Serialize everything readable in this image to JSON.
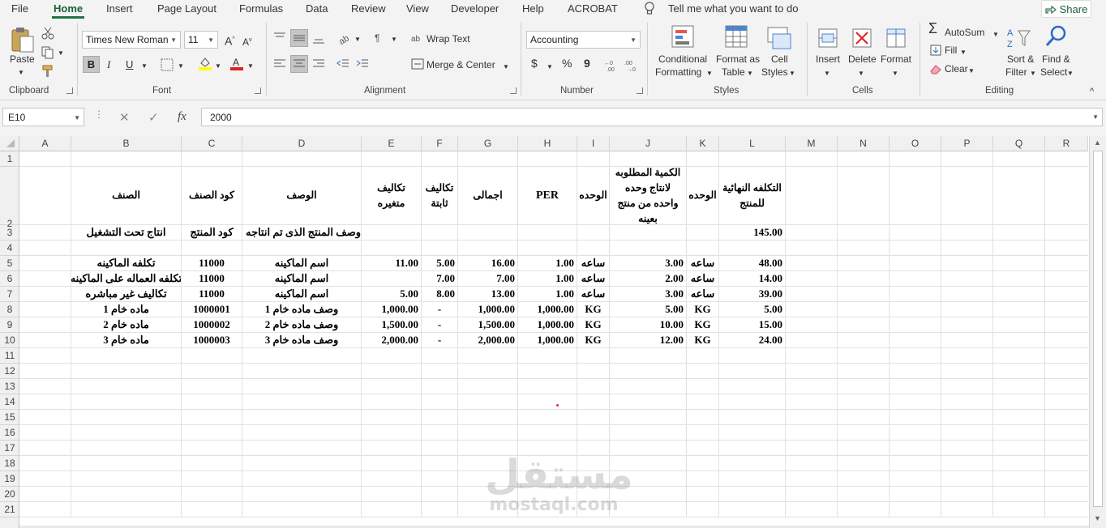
{
  "menu": {
    "tabs": [
      "File",
      "Home",
      "Insert",
      "Page Layout",
      "Formulas",
      "Data",
      "Review",
      "View",
      "Developer",
      "Help",
      "ACROBAT"
    ],
    "tell_me": "Tell me what you want to do",
    "share": "Share"
  },
  "ribbon": {
    "clipboard": {
      "paste": "Paste",
      "label": "Clipboard"
    },
    "font": {
      "name": "Times New Roman",
      "size": "11",
      "bold": "B",
      "italic": "I",
      "underline": "U",
      "label": "Font"
    },
    "alignment": {
      "wrap_text": "Wrap Text",
      "merge_center": "Merge & Center",
      "label": "Alignment"
    },
    "number": {
      "format": "Accounting",
      "currency": "$",
      "percent": "%",
      "comma": "9",
      "label": "Number"
    },
    "styles": {
      "conditional_formatting": [
        "Conditional",
        "Formatting"
      ],
      "format_as_table": [
        "Format as",
        "Table"
      ],
      "cell_styles": [
        "Cell",
        "Styles"
      ],
      "label": "Styles"
    },
    "cells": {
      "insert": "Insert",
      "delete": "Delete",
      "format": "Format",
      "label": "Cells"
    },
    "editing": {
      "autosum": "AutoSum",
      "fill": "Fill",
      "clear": "Clear",
      "sort_filter": [
        "Sort &",
        "Filter"
      ],
      "find_select": [
        "Find &",
        "Select"
      ],
      "label": "Editing"
    }
  },
  "formula_bar": {
    "name_box": "E10",
    "fx": "fx",
    "value": "2000"
  },
  "columns": [
    "A",
    "B",
    "C",
    "D",
    "E",
    "F",
    "G",
    "H",
    "I",
    "J",
    "K",
    "L",
    "M",
    "N",
    "O",
    "P",
    "Q",
    "R"
  ],
  "rows": [
    "1",
    "2",
    "3",
    "4",
    "5",
    "6",
    "7",
    "8",
    "9",
    "10",
    "11",
    "12",
    "13",
    "14",
    "15",
    "16",
    "17",
    "18",
    "19",
    "20",
    "21"
  ],
  "sheet": {
    "header": {
      "B": "الصنف",
      "C": "كود الصنف",
      "D": "الوصف",
      "E": "تكاليف متغيره",
      "F": "تكاليف ثابتة",
      "G": "اجمالى",
      "H": "PER",
      "I": "الوحده",
      "J": "الكمية المطلوبه لانتاج وحده واحده من منتج بعينه",
      "K": "الوحده",
      "L": "التكلفه النهائية للمنتج"
    },
    "row3": {
      "B": "انتاج تحت التشغيل",
      "C": "كود المنتج",
      "D": "وصف المنتج الذى تم انتاجه",
      "L": "145.00"
    },
    "data": [
      {
        "row": "5",
        "B": "تكلفه الماكينه",
        "C": "11000",
        "D": "اسم الماكينه",
        "E": "11.00",
        "F": "5.00",
        "G": "16.00",
        "H": "1.00",
        "I": "ساعه",
        "J": "3.00",
        "K": "ساعه",
        "L": "48.00"
      },
      {
        "row": "6",
        "B": "تكلفه العماله على الماكينه",
        "C": "11000",
        "D": "اسم الماكينه",
        "E": "",
        "F": "7.00",
        "G": "7.00",
        "H": "1.00",
        "I": "ساعه",
        "J": "2.00",
        "K": "ساعه",
        "L": "14.00"
      },
      {
        "row": "7",
        "B": "تكاليف غير مباشره",
        "C": "11000",
        "D": "اسم الماكينه",
        "E": "5.00",
        "F": "8.00",
        "G": "13.00",
        "H": "1.00",
        "I": "ساعه",
        "J": "3.00",
        "K": "ساعه",
        "L": "39.00"
      },
      {
        "row": "8",
        "B": "ماده خام 1",
        "C": "1000001",
        "D": "وصف ماده خام 1",
        "E": "1,000.00",
        "F": "-",
        "G": "1,000.00",
        "H": "1,000.00",
        "I": "KG",
        "J": "5.00",
        "K": "KG",
        "L": "5.00"
      },
      {
        "row": "9",
        "B": "ماده خام 2",
        "C": "1000002",
        "D": "وصف ماده خام 2",
        "E": "1,500.00",
        "F": "-",
        "G": "1,500.00",
        "H": "1,000.00",
        "I": "KG",
        "J": "10.00",
        "K": "KG",
        "L": "15.00"
      },
      {
        "row": "10",
        "B": "ماده خام 3",
        "C": "1000003",
        "D": "وصف ماده خام 3",
        "E": "2,000.00",
        "F": "-",
        "G": "2,000.00",
        "H": "1,000.00",
        "I": "KG",
        "J": "12.00",
        "K": "KG",
        "L": "24.00"
      }
    ]
  },
  "watermark": {
    "arabic": "مستقل",
    "latin": "mostaql.com"
  }
}
